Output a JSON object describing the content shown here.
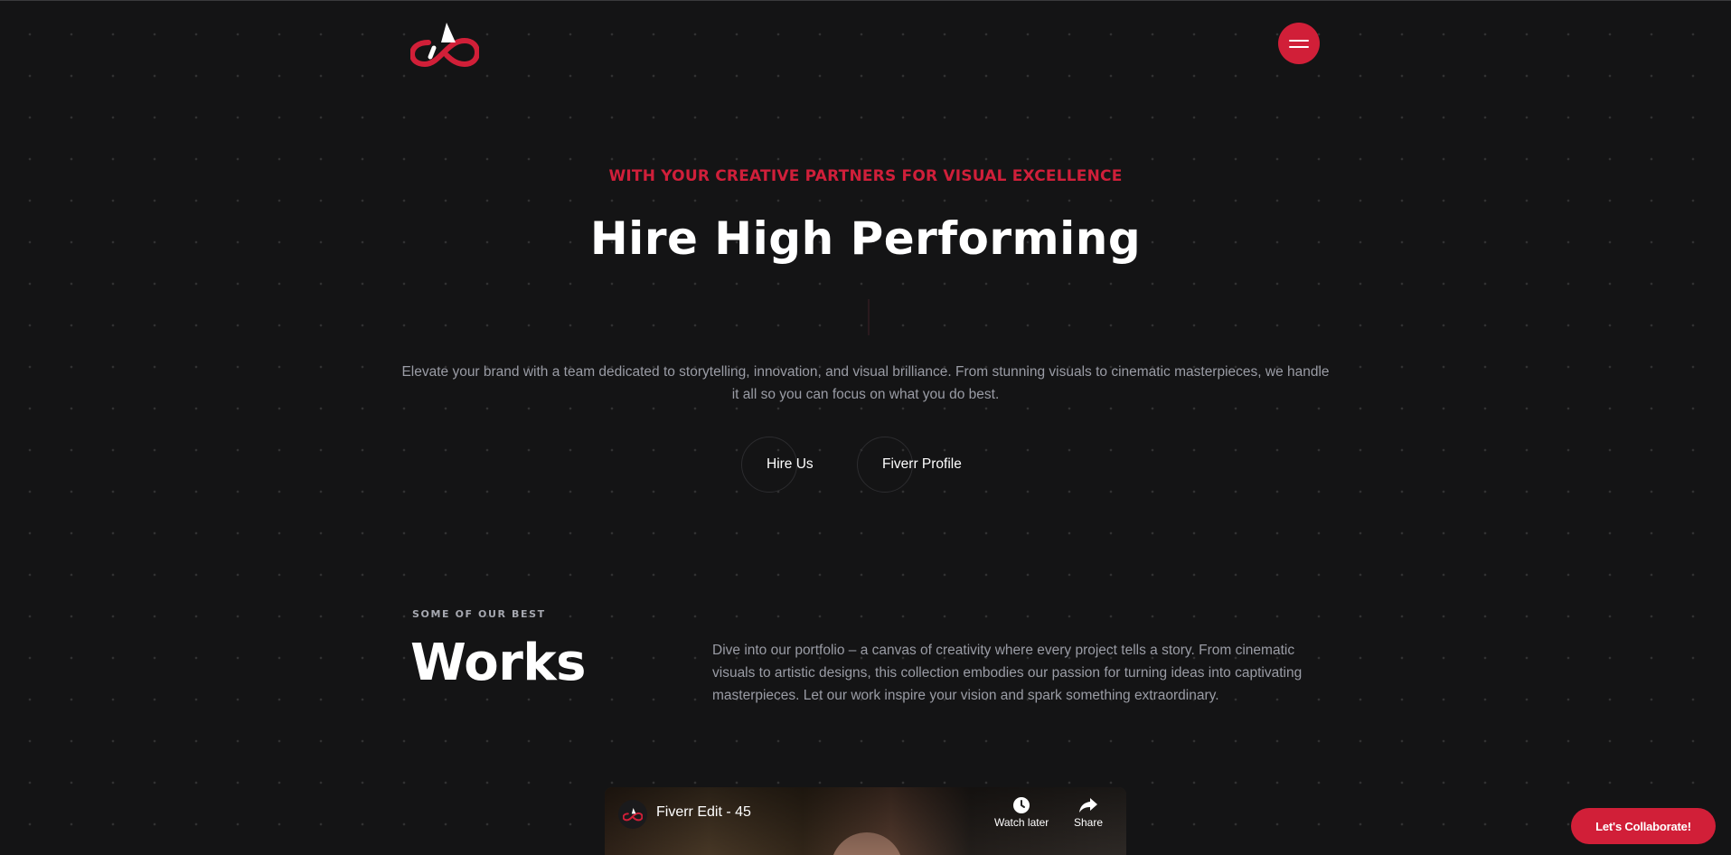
{
  "header": {
    "logo_icon": "brand-logo-icon",
    "menu_icon": "hamburger-menu-icon"
  },
  "hero": {
    "eyebrow": "WITH YOUR CREATIVE PARTNERS FOR VISUAL EXCELLENCE",
    "headline": "Hire High Performing",
    "description": "Elevate your brand with a team dedicated to storytelling, innovation, and visual brilliance. From stunning visuals to cinematic masterpieces, we handle it all so you can focus on what you do best.",
    "buttons": [
      {
        "label": "Hire Us"
      },
      {
        "label": "Fiverr Profile"
      }
    ]
  },
  "works": {
    "eyebrow": "SOME OF OUR BEST",
    "title": "Works",
    "description": "Dive into our portfolio – a canvas of creativity where every project tells a story. From cinematic visuals to artistic designs, this collection embodies our passion for turning ideas into captivating masterpieces. Let our work inspire your vision and spark something extraordinary."
  },
  "video": {
    "title": "Fiverr Edit - 45",
    "watch_later": "Watch later",
    "share": "Share"
  },
  "floating": {
    "collab_label": "Let's Collaborate!"
  },
  "colors": {
    "background": "#141415",
    "accent": "#d11f38",
    "muted_text": "#9a9ca5"
  }
}
